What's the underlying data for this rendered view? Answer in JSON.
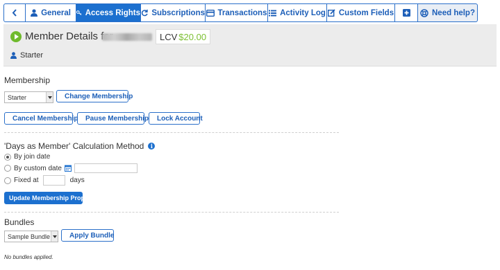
{
  "tabs": [
    {
      "icon": "chevron-left-icon",
      "label": ""
    },
    {
      "icon": "user-icon",
      "label": "General"
    },
    {
      "icon": "key-icon",
      "label": "Access Rights"
    },
    {
      "icon": "refresh-icon",
      "label": "Subscriptions"
    },
    {
      "icon": "credit-card-icon",
      "label": "Transactions"
    },
    {
      "icon": "list-icon",
      "label": "Activity Log"
    },
    {
      "icon": "edit-icon",
      "label": "Custom Fields"
    },
    {
      "icon": "plus-square-icon",
      "label": ""
    },
    {
      "icon": "lifebuoy-icon",
      "label": "Need help?"
    }
  ],
  "active_tab": "Access Rights",
  "header": {
    "title": "Member Details for",
    "lcv_label": "LCV",
    "lcv_value": "$20.00",
    "level": "Starter"
  },
  "membership": {
    "heading": "Membership",
    "selected": "Starter",
    "change_button": "Change Membership",
    "cancel_button": "Cancel Membership",
    "pause_button": "Pause Membership",
    "lock_button": "Lock Account"
  },
  "days_method": {
    "heading": "'Days as Member' Calculation Method",
    "option_join": "By join date",
    "option_custom": "By custom date",
    "option_fixed": "Fixed at",
    "fixed_suffix": "days",
    "selected": "By join date",
    "update_button": "Update Membership Properties"
  },
  "bundles": {
    "heading": "Bundles",
    "selected": "Sample Bundle",
    "apply_button": "Apply Bundle",
    "note": "No bundles applied."
  },
  "colors": {
    "accent": "#1c70cf",
    "lcv_green": "#7cbf32",
    "cancel_red": "#c62828",
    "pause_teal": "#26b5a6",
    "lock_gold": "#f0b429"
  }
}
